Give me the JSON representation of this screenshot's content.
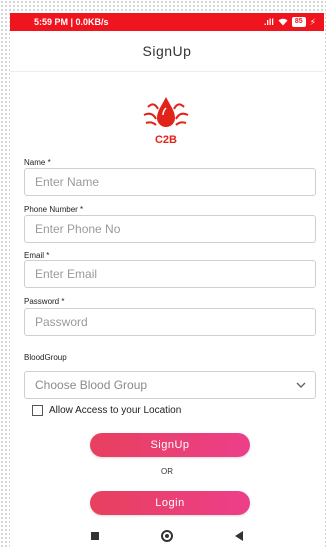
{
  "status_bar": {
    "time_speed": "5:59 PM | 0.0KB/s",
    "signal": ".ıll",
    "battery": "85",
    "color": "#f0141e"
  },
  "app_bar": {
    "title": "SignUp"
  },
  "logo": {
    "text": "C2B",
    "color": "#e2231a"
  },
  "form": {
    "name": {
      "label": "Name *",
      "placeholder": "Enter Name"
    },
    "phone": {
      "label": "Phone Number *",
      "placeholder": "Enter Phone No"
    },
    "email": {
      "label": "Email *",
      "placeholder": "Enter Email"
    },
    "password": {
      "label": "Password *",
      "placeholder": "Password"
    },
    "blood_group": {
      "label": "BloodGroup",
      "value": "Choose Blood Group"
    },
    "location": {
      "label": "Allow Access to your Location",
      "checked": false
    }
  },
  "buttons": {
    "signup": "SignUp",
    "or": "OR",
    "login": "Login",
    "gradient_start": "#e8405e",
    "gradient_end": "#ec3f8a"
  },
  "nav_icons": [
    "recent-apps-icon",
    "home-icon",
    "back-icon"
  ]
}
